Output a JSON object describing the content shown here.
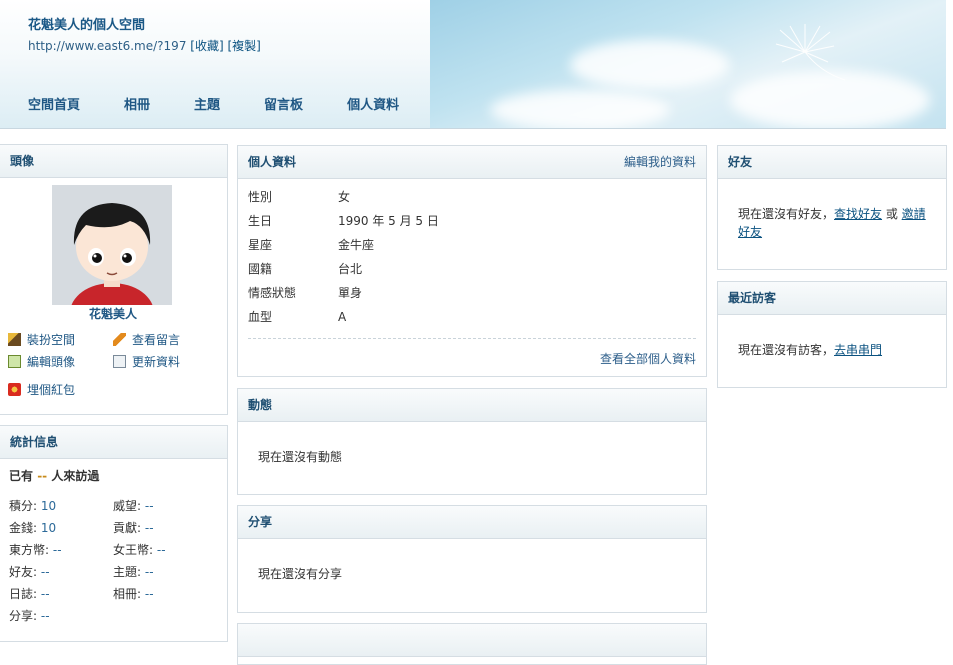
{
  "header": {
    "title": "花魁美人的個人空間",
    "url": "http://www.east6.me/?197",
    "bookmark": "[收藏]",
    "copy": "[複製]",
    "nav": [
      "空間首頁",
      "相冊",
      "主題",
      "留言板",
      "個人資料"
    ]
  },
  "avatar_panel": {
    "title": "頭像",
    "username": "花魁美人",
    "actions": [
      "裝扮空間",
      "查看留言",
      "編輯頭像",
      "更新資料",
      "埋個紅包"
    ]
  },
  "stats_panel": {
    "title": "統計信息",
    "visits_prefix": "已有",
    "visits_count": "--",
    "visits_suffix": "人來訪過",
    "items": [
      {
        "label": "積分:",
        "value": "10"
      },
      {
        "label": "威望:",
        "value": "--"
      },
      {
        "label": "金錢:",
        "value": "10"
      },
      {
        "label": "貢獻:",
        "value": "--"
      },
      {
        "label": "東方幣:",
        "value": "--"
      },
      {
        "label": "女王幣:",
        "value": "--"
      },
      {
        "label": "好友:",
        "value": "--"
      },
      {
        "label": "主題:",
        "value": "--"
      },
      {
        "label": "日誌:",
        "value": "--"
      },
      {
        "label": "相冊:",
        "value": "--"
      },
      {
        "label": "分享:",
        "value": "--"
      }
    ]
  },
  "profile_panel": {
    "title": "個人資料",
    "edit_link": "編輯我的資料",
    "rows": [
      {
        "label": "性別",
        "value": "女"
      },
      {
        "label": "生日",
        "value": "1990 年 5 月 5 日"
      },
      {
        "label": "星座",
        "value": "金牛座"
      },
      {
        "label": "國籍",
        "value": "台北"
      },
      {
        "label": "情感狀態",
        "value": "單身"
      },
      {
        "label": "血型",
        "value": "A"
      }
    ],
    "view_all": "查看全部個人資料"
  },
  "activity_panel": {
    "title": "動態",
    "empty": "現在還沒有動態"
  },
  "share_panel": {
    "title": "分享",
    "empty": "現在還沒有分享"
  },
  "friends_panel": {
    "title": "好友",
    "text": "現在還沒有好友，",
    "find_link": "查找好友",
    "or": " 或 ",
    "invite_link": "邀請好友"
  },
  "visitors_panel": {
    "title": "最近訪客",
    "text": "現在還沒有訪客，",
    "link": "去串串門"
  },
  "colors": {
    "accent": "#1f5784",
    "link": "#2c6a99",
    "panel_border": "#d5dde3"
  }
}
